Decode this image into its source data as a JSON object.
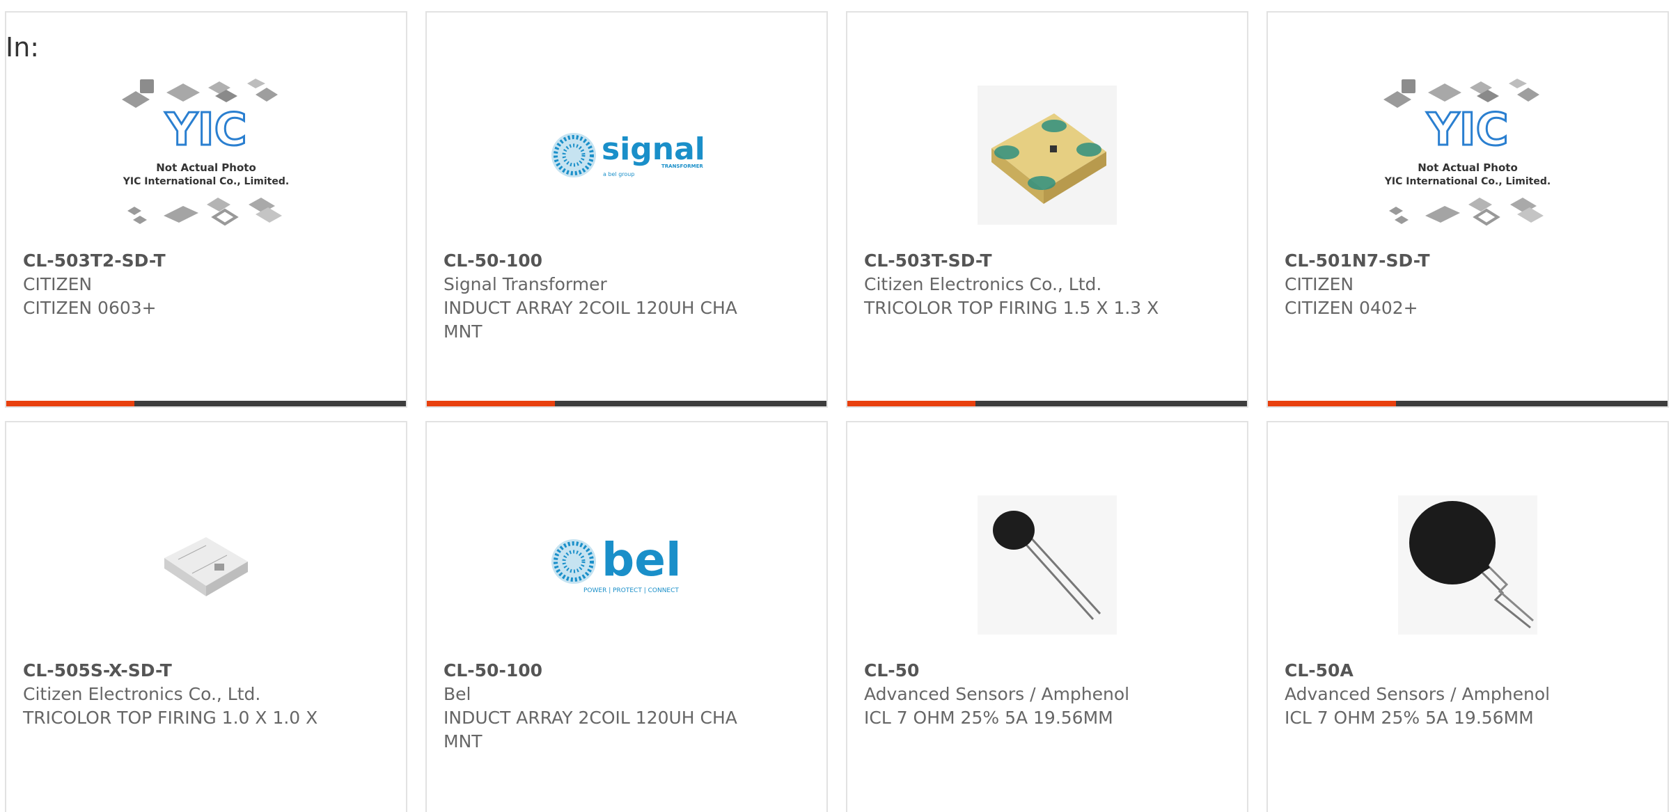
{
  "filter_label": "In:",
  "products": [
    {
      "part_number": "CL-503T2-SD-T",
      "manufacturer": "CITIZEN",
      "description": "CITIZEN 0603+",
      "image": "yic-placeholder",
      "placeholder_text_1": "Not Actual Photo",
      "placeholder_text_2": "YIC International Co., Limited.",
      "placeholder_logo": "YIC"
    },
    {
      "part_number": "CL-50-100",
      "manufacturer": "Signal Transformer",
      "description": "INDUCT ARRAY 2COIL 120UH CHA MNT",
      "image": "signal-logo",
      "logo_text": "signal",
      "logo_subtext": "TRANSFORMER",
      "logo_tagline": "a bel group"
    },
    {
      "part_number": "CL-503T-SD-T",
      "manufacturer": "Citizen Electronics Co., Ltd.",
      "description": "TRICOLOR TOP FIRING 1.5 X 1.3 X",
      "image": "led-chip-photo"
    },
    {
      "part_number": "CL-501N7-SD-T",
      "manufacturer": "CITIZEN",
      "description": "CITIZEN 0402+",
      "image": "yic-placeholder",
      "placeholder_text_1": "Not Actual Photo",
      "placeholder_text_2": "YIC International Co., Limited.",
      "placeholder_logo": "YIC"
    },
    {
      "part_number": "CL-505S-X-SD-T",
      "manufacturer": "Citizen Electronics Co., Ltd.",
      "description": "TRICOLOR TOP FIRING 1.0 X 1.0 X",
      "image": "white-led-photo"
    },
    {
      "part_number": "CL-50-100",
      "manufacturer": "Bel",
      "description": "INDUCT ARRAY 2COIL 120UH CHA MNT",
      "image": "bel-logo",
      "logo_text": "bel",
      "logo_tagline": "POWER | PROTECT | CONNECT"
    },
    {
      "part_number": "CL-50",
      "manufacturer": "Advanced Sensors / Amphenol",
      "description": "ICL 7 OHM 25% 5A 19.56MM",
      "image": "thermistor-small-photo"
    },
    {
      "part_number": "CL-50A",
      "manufacturer": "Advanced Sensors / Amphenol",
      "description": "ICL 7 OHM 25% 5A 19.56MM",
      "image": "thermistor-large-photo"
    }
  ],
  "colors": {
    "accent": "#e8400e",
    "bar_dark": "#3d3d3d",
    "signal_blue": "#1a8fc9",
    "yic_blue": "#2a7fd0"
  }
}
